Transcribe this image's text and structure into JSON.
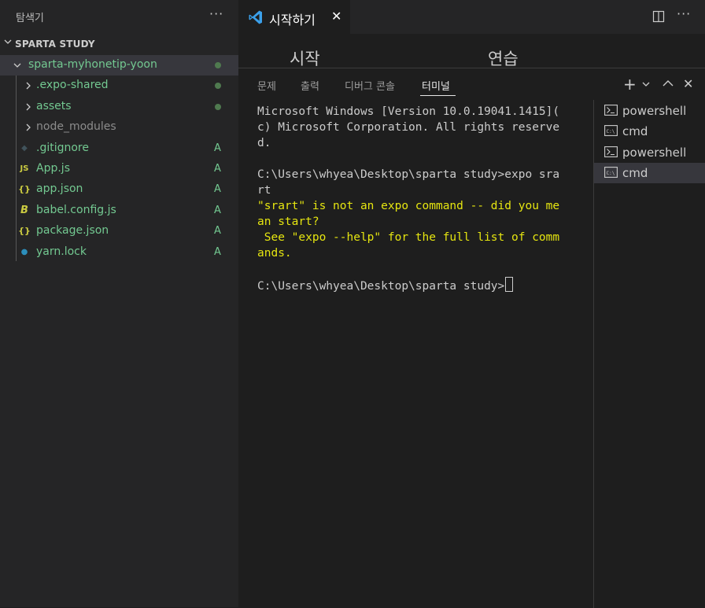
{
  "sidebar": {
    "title": "탐색기",
    "more": "···",
    "section": "SPARTA STUDY",
    "rows": [
      {
        "name": "sparta-myhonetip-yoon",
        "kind": "folder-open",
        "status": "dot",
        "color": "#73c991"
      },
      {
        "name": ".expo-shared",
        "kind": "folder",
        "status": "dot",
        "color": "#73c991"
      },
      {
        "name": "assets",
        "kind": "folder",
        "status": "dot",
        "color": "#73c991"
      },
      {
        "name": "node_modules",
        "kind": "folder",
        "status": "",
        "color": "#8c8c8c"
      },
      {
        "name": ".gitignore",
        "kind": "file",
        "icon": "git-icon",
        "status": "A",
        "color": "#73c991"
      },
      {
        "name": "App.js",
        "kind": "file",
        "icon": "js-icon",
        "icon_text": "JS",
        "status": "A",
        "color": "#73c991"
      },
      {
        "name": "app.json",
        "kind": "file",
        "icon": "json-icon",
        "icon_text": "{}",
        "status": "A",
        "color": "#73c991"
      },
      {
        "name": "babel.config.js",
        "kind": "file",
        "icon": "babel-icon",
        "icon_text": "B",
        "status": "A",
        "color": "#73c991"
      },
      {
        "name": "package.json",
        "kind": "file",
        "icon": "json-icon",
        "icon_text": "{}",
        "status": "A",
        "color": "#73c991"
      },
      {
        "name": "yarn.lock",
        "kind": "file",
        "icon": "yarn-icon",
        "status": "A",
        "color": "#73c991"
      }
    ]
  },
  "tabs": {
    "active_label": "시작하기",
    "close": "✕",
    "more": "···"
  },
  "editor": {
    "heading_left": "시작",
    "heading_right": "연습"
  },
  "panel": {
    "tabs": [
      "문제",
      "출력",
      "디버그 콘솔",
      "터미널"
    ],
    "active_tab": "터미널",
    "actions": {
      "add": "+",
      "dropdown": "⌄",
      "maximize": "⌃",
      "close": "✕"
    }
  },
  "terminal": {
    "lines": [
      {
        "text": "Microsoft Windows [Version 10.0.19041.1415](",
        "style": "normal"
      },
      {
        "text": "c) Microsoft Corporation. All rights reserve",
        "style": "normal"
      },
      {
        "text": "d.",
        "style": "normal"
      },
      {
        "text": "",
        "style": "normal"
      },
      {
        "text": "C:\\Users\\whyea\\Desktop\\sparta study>expo sra",
        "style": "normal"
      },
      {
        "text": "rt",
        "style": "normal"
      },
      {
        "text": "\"srart\" is not an expo command -- did you me",
        "style": "yellow"
      },
      {
        "text": "an start?",
        "style": "yellow"
      },
      {
        "text": " See \"expo --help\" for the full list of comm",
        "style": "yellow"
      },
      {
        "text": "ands.",
        "style": "yellow"
      },
      {
        "text": "",
        "style": "normal"
      },
      {
        "text": "C:\\Users\\whyea\\Desktop\\sparta study>",
        "style": "prompt"
      }
    ],
    "instances": [
      {
        "label": "powershell",
        "icon": "powershell-icon",
        "selected": false
      },
      {
        "label": "cmd",
        "icon": "cmd-icon",
        "selected": false
      },
      {
        "label": "powershell",
        "icon": "powershell-icon",
        "selected": false
      },
      {
        "label": "cmd",
        "icon": "cmd-icon",
        "selected": true
      }
    ]
  },
  "colors": {
    "added": "#73c991",
    "warning": "#e5e510",
    "vscode_blue": "#3ba0ea"
  }
}
